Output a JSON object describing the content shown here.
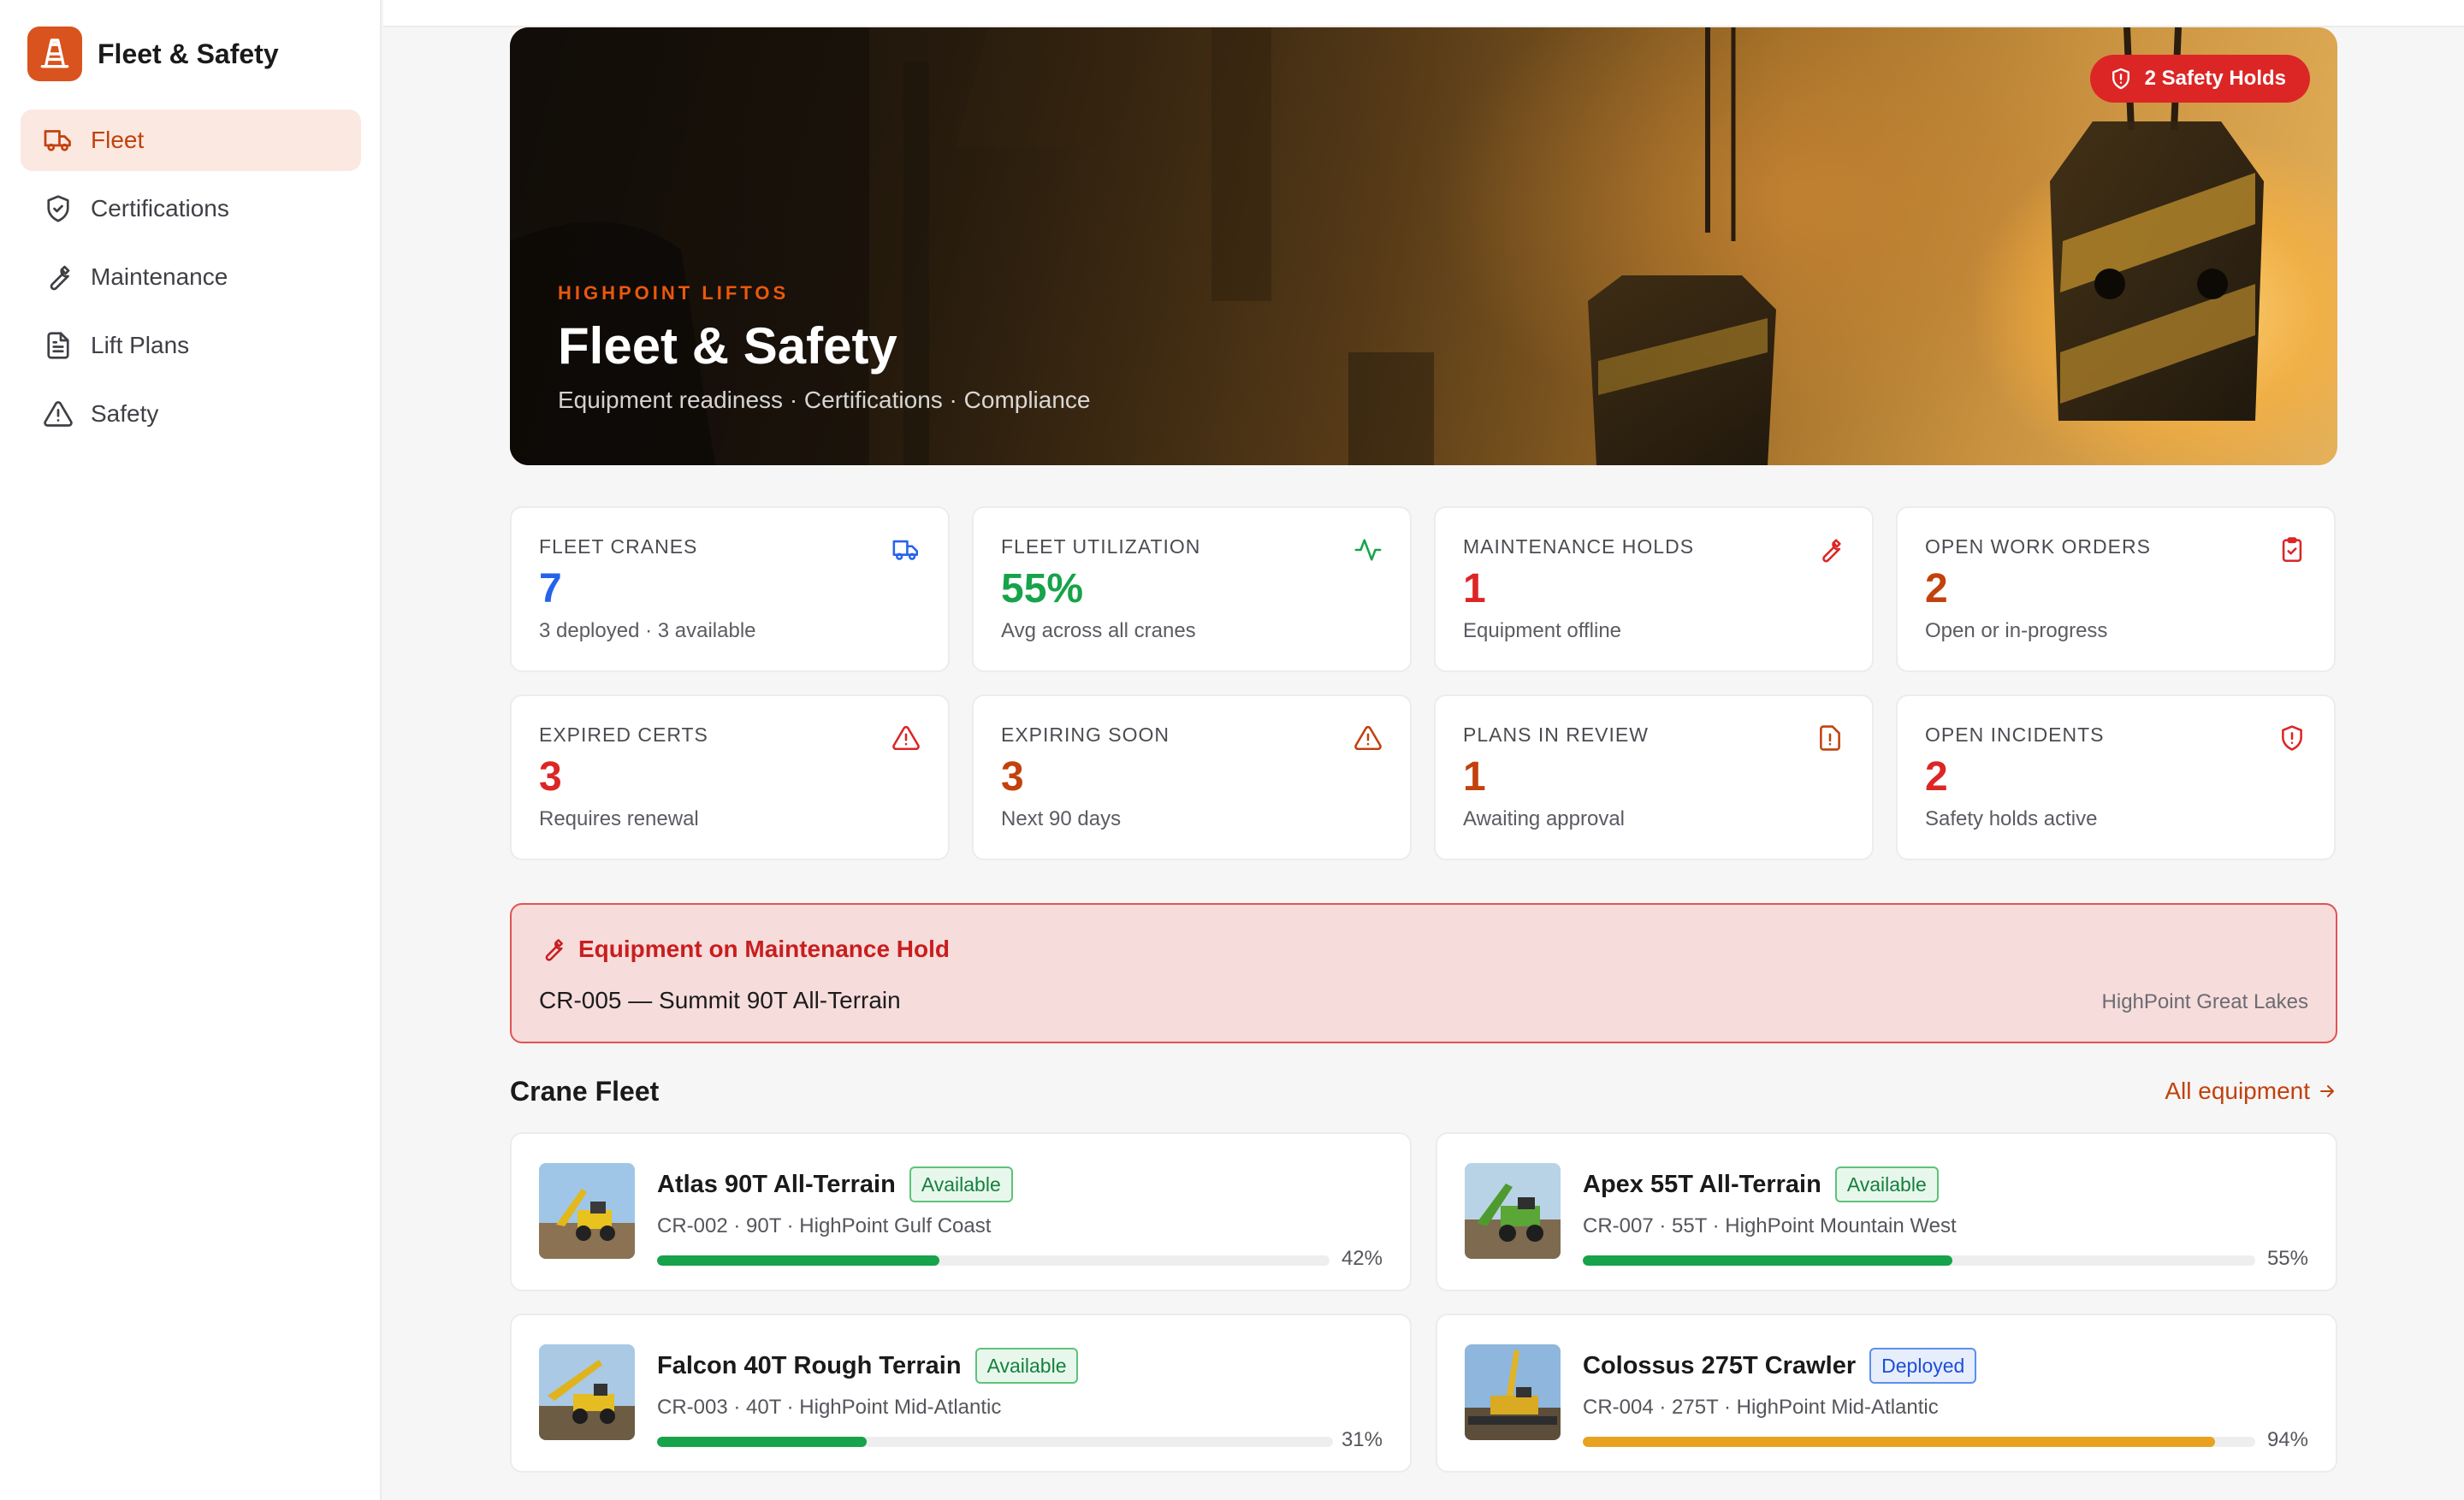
{
  "brand": {
    "name": "Fleet & Safety",
    "color": "#d9531e"
  },
  "nav": [
    {
      "label": "Fleet",
      "icon": "truck-icon",
      "active": true
    },
    {
      "label": "Certifications",
      "icon": "shield-check-icon",
      "active": false
    },
    {
      "label": "Maintenance",
      "icon": "wrench-icon",
      "active": false
    },
    {
      "label": "Lift Plans",
      "icon": "file-text-icon",
      "active": false
    },
    {
      "label": "Safety",
      "icon": "warning-triangle-icon",
      "active": false
    }
  ],
  "hero": {
    "kicker": "HIGHPOINT LIFTOS",
    "title": "Fleet & Safety",
    "subtitle": "Equipment readiness · Certifications · Compliance",
    "hold_pill": "2 Safety Holds"
  },
  "stats": [
    {
      "label": "FLEET CRANES",
      "value": "7",
      "sub": "3 deployed · 3 available",
      "color": "#2563eb",
      "icon": "truck-icon"
    },
    {
      "label": "FLEET UTILIZATION",
      "value": "55%",
      "sub": "Avg across all cranes",
      "color": "#16a34a",
      "icon": "activity-icon"
    },
    {
      "label": "MAINTENANCE HOLDS",
      "value": "1",
      "sub": "Equipment offline",
      "color": "#dc2626",
      "icon": "wrench-icon"
    },
    {
      "label": "OPEN WORK ORDERS",
      "value": "2",
      "sub": "Open or in-progress",
      "color": "#c2410c",
      "icon": "clipboard-check-icon"
    },
    {
      "label": "EXPIRED CERTS",
      "value": "3",
      "sub": "Requires renewal",
      "color": "#dc2626",
      "icon": "warning-triangle-icon"
    },
    {
      "label": "EXPIRING SOON",
      "value": "3",
      "sub": "Next 90 days",
      "color": "#c2410c",
      "icon": "warning-triangle-icon"
    },
    {
      "label": "PLANS IN REVIEW",
      "value": "1",
      "sub": "Awaiting approval",
      "color": "#c2410c",
      "icon": "file-alert-icon"
    },
    {
      "label": "OPEN INCIDENTS",
      "value": "2",
      "sub": "Safety holds active",
      "color": "#dc2626",
      "icon": "shield-alert-icon"
    }
  ],
  "alert": {
    "title": "Equipment on Maintenance Hold",
    "item": "CR-005 — Summit 90T All-Terrain",
    "location": "HighPoint Great Lakes"
  },
  "fleet": {
    "title": "Crane Fleet",
    "link": "All equipment",
    "cranes": [
      {
        "name": "Atlas 90T All-Terrain",
        "status": "Available",
        "status_kind": "available",
        "meta": "CR-002 · 90T · HighPoint Gulf Coast",
        "utilization": 42,
        "pct": "42%",
        "bar_color": "#16a34a"
      },
      {
        "name": "Apex 55T All-Terrain",
        "status": "Available",
        "status_kind": "available",
        "meta": "CR-007 · 55T · HighPoint Mountain West",
        "utilization": 55,
        "pct": "55%",
        "bar_color": "#16a34a"
      },
      {
        "name": "Falcon 40T Rough Terrain",
        "status": "Available",
        "status_kind": "available",
        "meta": "CR-003 · 40T · HighPoint Mid-Atlantic",
        "utilization": 31,
        "pct": "31%",
        "bar_color": "#16a34a"
      },
      {
        "name": "Colossus 275T Crawler",
        "status": "Deployed",
        "status_kind": "deployed",
        "meta": "CR-004 · 275T · HighPoint Mid-Atlantic",
        "utilization": 94,
        "pct": "94%",
        "bar_color": "#e8a21f"
      }
    ]
  }
}
